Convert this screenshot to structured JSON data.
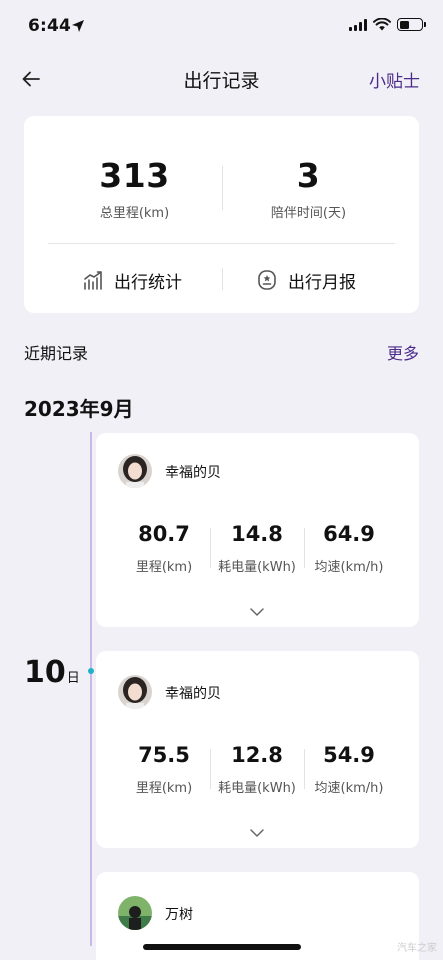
{
  "status": {
    "time": "6:44"
  },
  "nav": {
    "title": "出行记录",
    "tip": "小贴士"
  },
  "summary": {
    "mileage_value": "313",
    "mileage_label": "总里程(km)",
    "days_value": "3",
    "days_label": "陪伴时间(天)",
    "actions": [
      "出行统计",
      "出行月报"
    ]
  },
  "recent": {
    "title": "近期记录",
    "more": "更多"
  },
  "month": "2023年9月",
  "day": {
    "number": "10",
    "unit": "日"
  },
  "trips": [
    {
      "user": "幸福的贝",
      "stats": [
        {
          "value": "80.7",
          "label": "里程(km)"
        },
        {
          "value": "14.8",
          "label": "耗电量(kWh)"
        },
        {
          "value": "64.9",
          "label": "均速(km/h)"
        }
      ]
    },
    {
      "user": "幸福的贝",
      "stats": [
        {
          "value": "75.5",
          "label": "里程(km)"
        },
        {
          "value": "12.8",
          "label": "耗电量(kWh)"
        },
        {
          "value": "54.9",
          "label": "均速(km/h)"
        }
      ]
    },
    {
      "user": "万树"
    }
  ],
  "watermark": "汽车之家"
}
